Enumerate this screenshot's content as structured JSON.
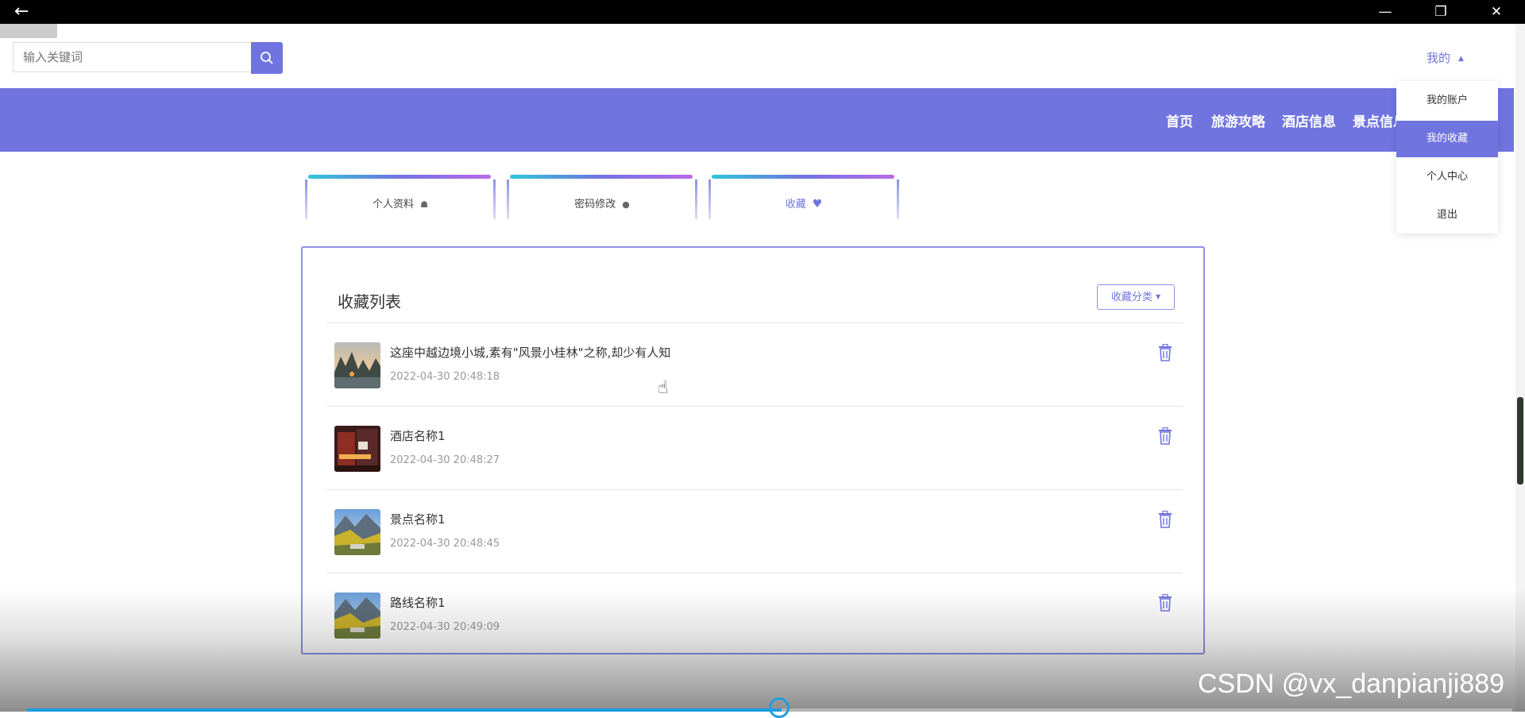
{
  "window": {
    "back_icon": "arrow-left-icon",
    "min_icon": "minimize-icon",
    "max_icon": "restore-icon",
    "close_icon": "close-icon",
    "min_glyph": "—",
    "max_glyph": "❐",
    "close_glyph": "✕",
    "back_glyph": "←"
  },
  "search": {
    "placeholder": "输入关键词",
    "button_icon": "search-icon"
  },
  "user_menu": {
    "label": "我的",
    "items": [
      "我的账户",
      "我的收藏",
      "个人中心",
      "退出"
    ],
    "active_index": 1
  },
  "nav": {
    "items": [
      "首页",
      "旅游攻略",
      "酒店信息",
      "景点信息"
    ]
  },
  "tabs": [
    {
      "label": "个人资料",
      "icon": "home-icon",
      "glyph": "☗"
    },
    {
      "label": "密码修改",
      "icon": "user-icon",
      "glyph": "●"
    },
    {
      "label": "收藏",
      "icon": "heart-icon",
      "glyph": "♥",
      "active": true
    }
  ],
  "favorites": {
    "title": "收藏列表",
    "category_button": "收藏分类",
    "items": [
      {
        "title": "这座中越边境小城,素有\"风景小桂林\"之称,却少有人知",
        "time": "2022-04-30 20:48:18",
        "thumb": "river-landscape"
      },
      {
        "title": "酒店名称1",
        "time": "2022-04-30 20:48:27",
        "thumb": "hotel-night"
      },
      {
        "title": "景点名称1",
        "time": "2022-04-30 20:48:45",
        "thumb": "mountain-valley"
      },
      {
        "title": "路线名称1",
        "time": "2022-04-30 20:49:09",
        "thumb": "mountain-valley"
      }
    ]
  },
  "watermark": "CSDN @vx_danpianji889",
  "colors": {
    "accent": "#7074df",
    "progress": "#1e9de0"
  }
}
